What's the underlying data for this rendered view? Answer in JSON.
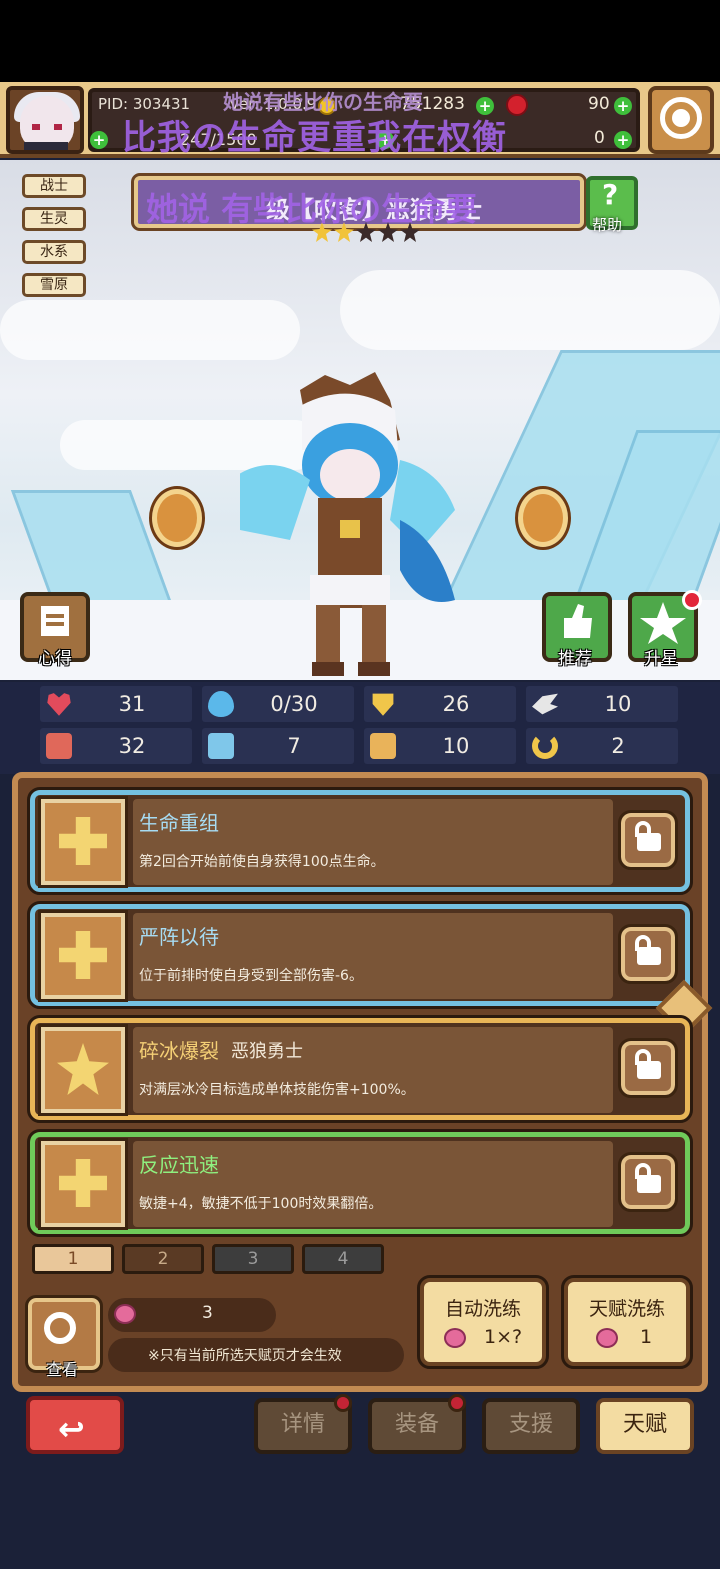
{
  "header": {
    "pid": "PID: 303431",
    "version": "ver: 1.0.0.9",
    "xp": "247/1500",
    "gold": "751283",
    "gems": "90",
    "gems_secondary": "0"
  },
  "danmaku": {
    "line1": "她说有些比你の生命要",
    "line2": "比我の生命更重我在权衡",
    "line3": "她说 有些比你の生命要"
  },
  "tags": [
    "战士",
    "生灵",
    "水系",
    "雪原"
  ],
  "hero": {
    "name": "级【叹客】恶狼勇士",
    "stars_filled": 2,
    "stars_total": 5
  },
  "help_label": "帮助",
  "buttons": {
    "notes": "心得",
    "recommend": "推荐",
    "upgrade_star": "升星"
  },
  "stats": [
    {
      "icon": "heart-icon",
      "value": "31",
      "color": "#e24b5c"
    },
    {
      "icon": "water-drop-icon",
      "value": "0/30",
      "color": "#5bb8ea"
    },
    {
      "icon": "shield-icon",
      "value": "26",
      "color": "#f0c64a"
    },
    {
      "icon": "wing-icon",
      "value": "10",
      "color": "#e6e6e6"
    },
    {
      "icon": "fist-icon",
      "value": "32",
      "color": "#e0685a"
    },
    {
      "icon": "book-icon",
      "value": "7",
      "color": "#7fc7ea"
    },
    {
      "icon": "scroll-icon",
      "value": "10",
      "color": "#e9b35a"
    },
    {
      "icon": "horseshoe-icon",
      "value": "2",
      "color": "#f0c64a"
    }
  ],
  "talents": [
    {
      "title": "生命重组",
      "subtitle": "",
      "desc": "第2回合开始前使自身获得100点生命。",
      "style": "blue"
    },
    {
      "title": "严阵以待",
      "subtitle": "",
      "desc": "位于前排时使自身受到全部伤害-6。",
      "style": "blue"
    },
    {
      "title": "碎冰爆裂",
      "subtitle": "恶狼勇士",
      "desc": "对满层冰冷目标造成单体技能伤害+100%。",
      "style": "gold"
    },
    {
      "title": "反应迅速",
      "subtitle": "",
      "desc": "敏捷+4，敏捷不低于100时效果翻倍。",
      "style": "green"
    }
  ],
  "pages": [
    "1",
    "2",
    "3",
    "4"
  ],
  "search_label": "查看",
  "peach_count": "3",
  "note": "※只有当前所选天赋页才会生效",
  "auto_wash": {
    "title": "自动洗练",
    "cost": "1×?"
  },
  "talent_wash": {
    "title": "天赋洗练",
    "cost": "1"
  },
  "nav": {
    "details": "详情",
    "equipment": "装备",
    "support": "支援",
    "talent": "天赋"
  }
}
